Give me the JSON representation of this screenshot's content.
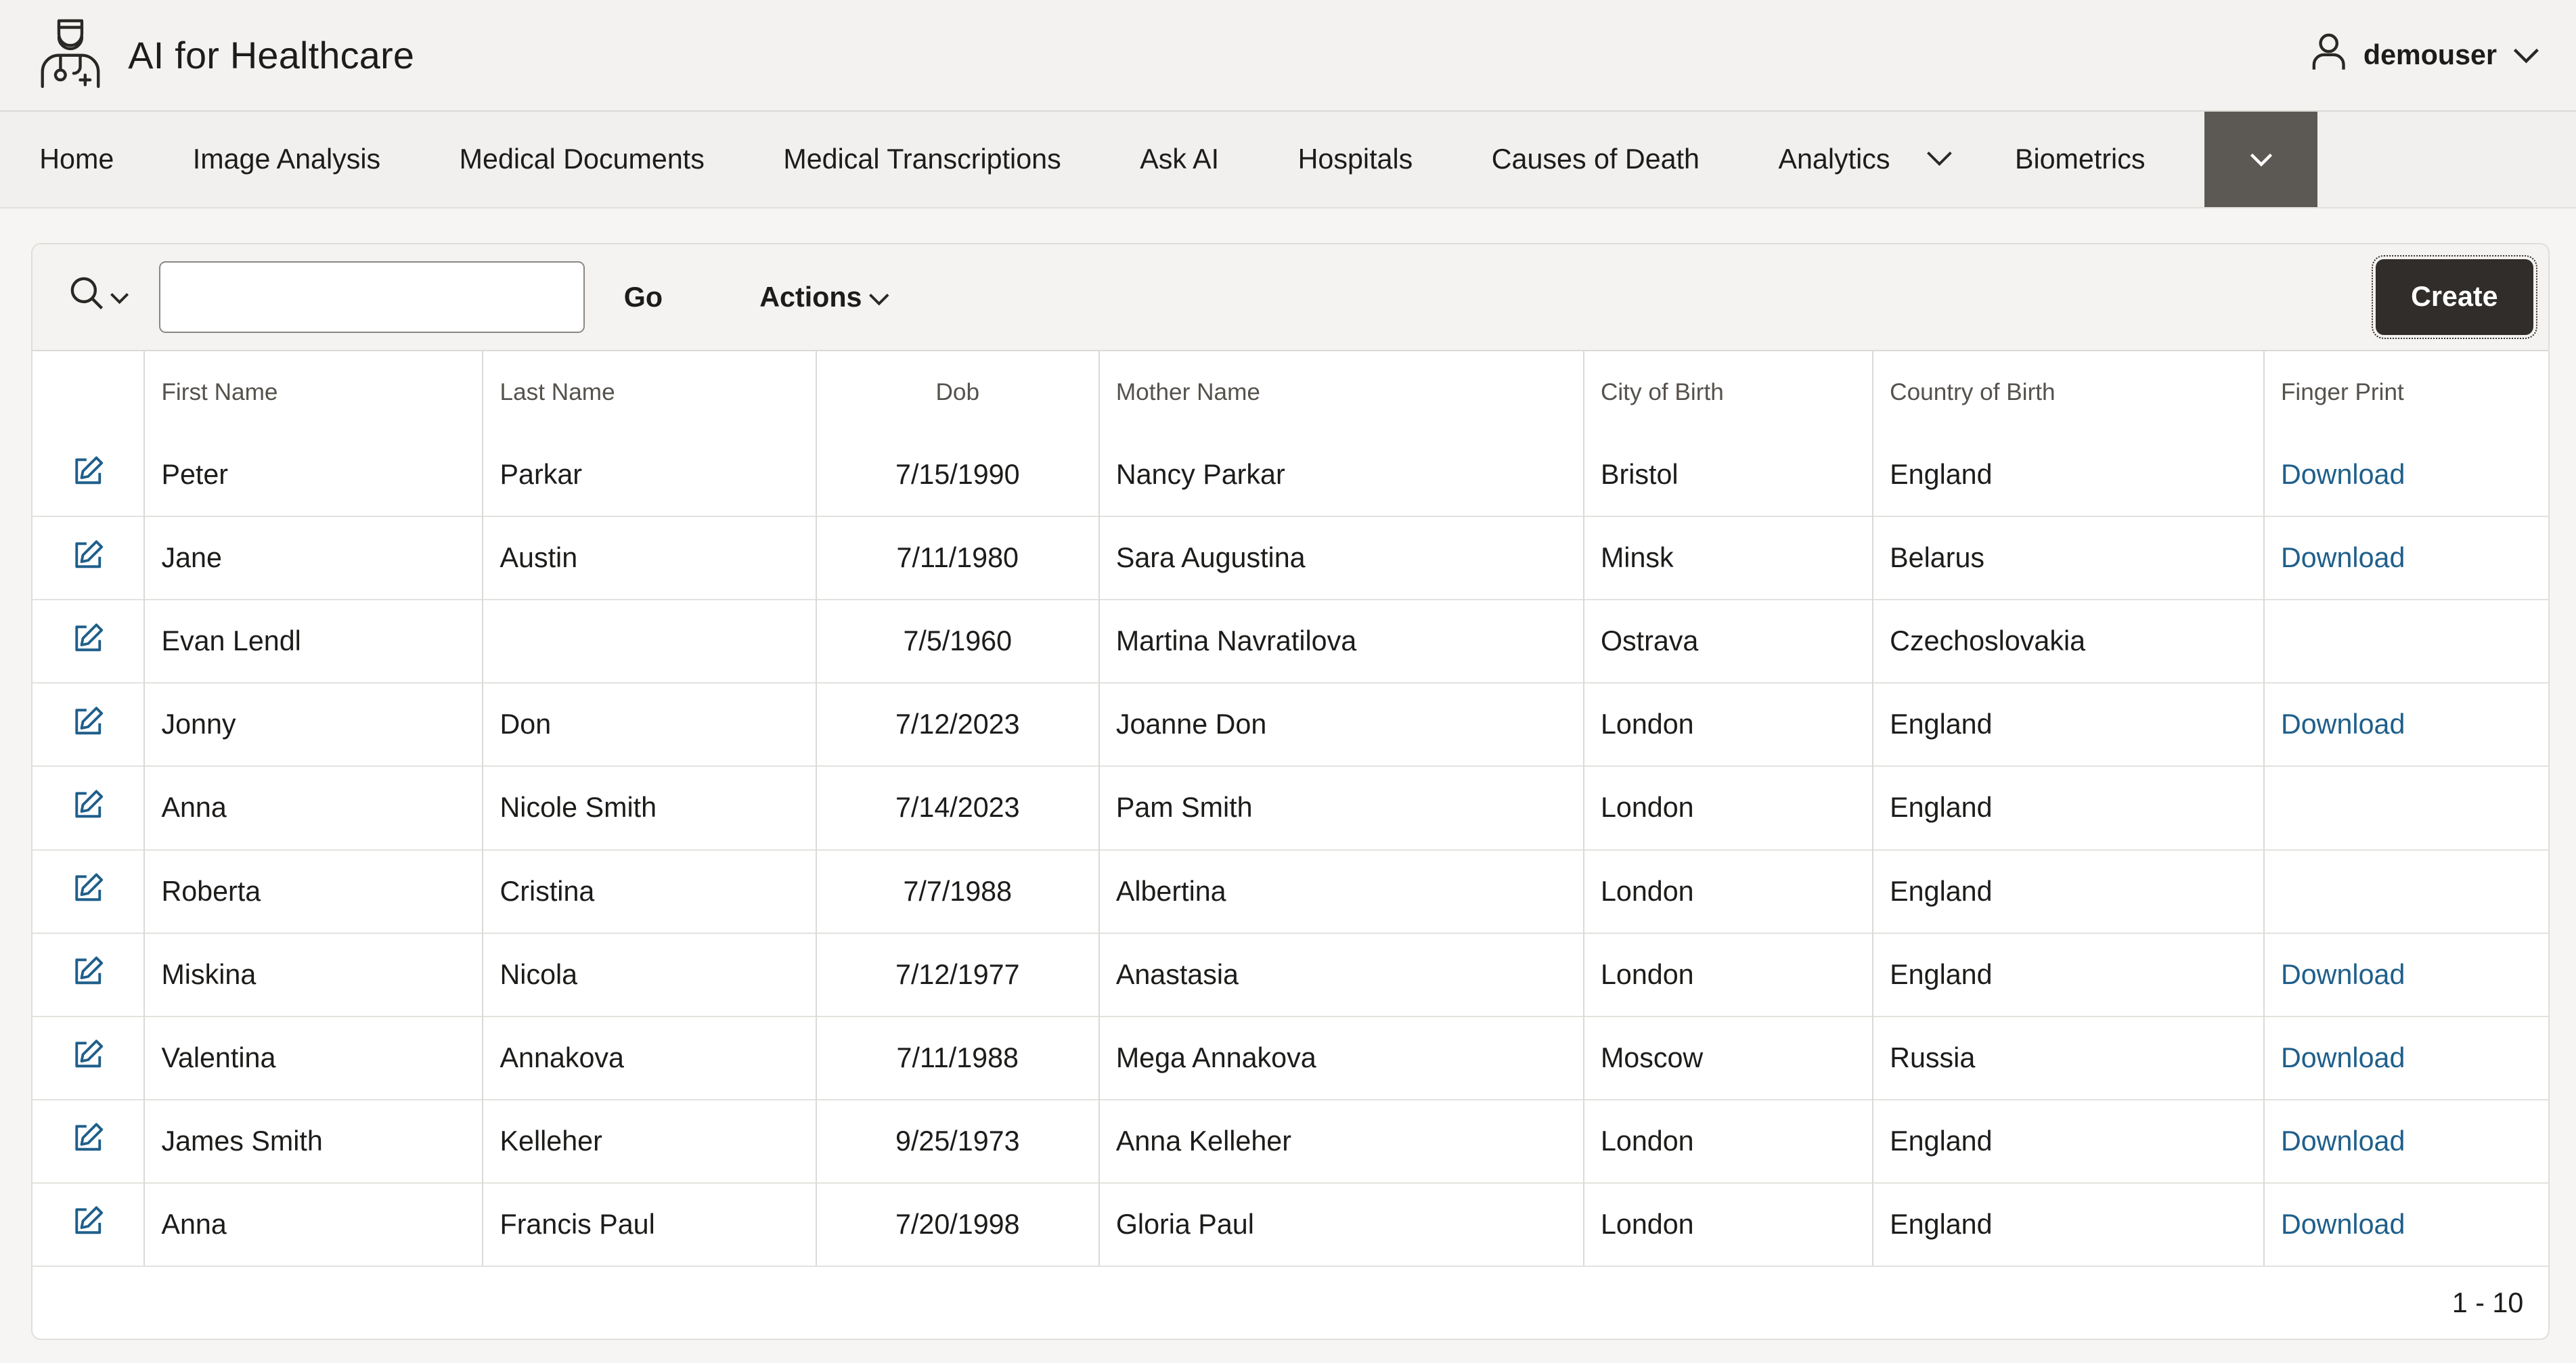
{
  "app": {
    "title": "AI for Healthcare",
    "user": "demouser"
  },
  "nav": {
    "items": [
      "Home",
      "Image Analysis",
      "Medical Documents",
      "Medical Transcriptions",
      "Ask AI",
      "Hospitals",
      "Causes of Death",
      "Analytics",
      "Biometrics"
    ]
  },
  "toolbar": {
    "search_value": "",
    "go_label": "Go",
    "actions_label": "Actions",
    "create_label": "Create"
  },
  "table": {
    "columns": [
      "First Name",
      "Last Name",
      "Dob",
      "Mother Name",
      "City of Birth",
      "Country of Birth",
      "Finger Print"
    ],
    "rows": [
      [
        "Peter",
        "Parkar",
        "7/15/1990",
        "Nancy Parkar",
        "Bristol",
        "England",
        "Download"
      ],
      [
        "Jane",
        "Austin",
        "7/11/1980",
        "Sara Augustina",
        "Minsk",
        "Belarus",
        "Download"
      ],
      [
        "Evan Lendl",
        "",
        "7/5/1960",
        "Martina Navratilova",
        "Ostrava",
        "Czechoslovakia",
        ""
      ],
      [
        "Jonny",
        "Don",
        "7/12/2023",
        "Joanne Don",
        "London",
        "England",
        "Download"
      ],
      [
        "Anna",
        "Nicole Smith",
        "7/14/2023",
        "Pam Smith",
        "London",
        "England",
        ""
      ],
      [
        "Roberta",
        "Cristina",
        "7/7/1988",
        "Albertina",
        "London",
        "England",
        ""
      ],
      [
        "Miskina",
        "Nicola",
        "7/12/1977",
        "Anastasia",
        "London",
        "England",
        "Download"
      ],
      [
        "Valentina",
        "Annakova",
        "7/11/1988",
        "Mega Annakova",
        "Moscow",
        "Russia",
        "Download"
      ],
      [
        "James Smith",
        "Kelleher",
        "9/25/1973",
        "Anna Kelleher",
        "London",
        "England",
        "Download"
      ],
      [
        "Anna",
        "Francis Paul",
        "7/20/1998",
        "Gloria Paul",
        "London",
        "England",
        "Download"
      ]
    ]
  },
  "pagination": {
    "range": "1 - 10"
  },
  "colors": {
    "primary_button": "#312d2a",
    "link": "#1f5f8b",
    "nav_active": "#5c5954"
  }
}
